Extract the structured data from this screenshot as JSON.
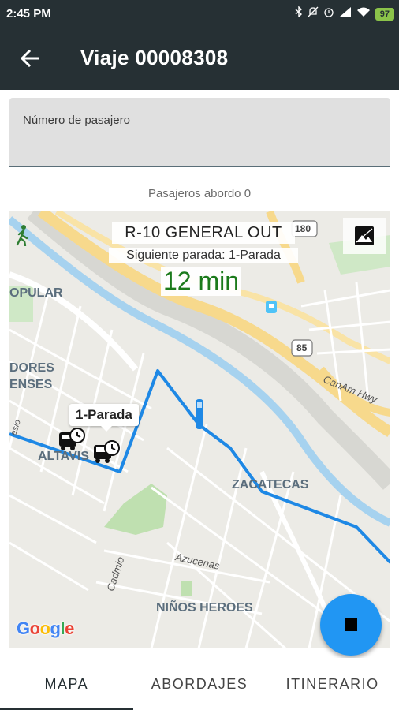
{
  "status_bar": {
    "time": "2:45 PM",
    "battery": "97",
    "icons": [
      "bluetooth-icon",
      "mute-icon",
      "alarm-icon",
      "signal-icon",
      "wifi-icon",
      "battery-icon"
    ]
  },
  "app_bar": {
    "back_icon": "arrow-left-icon",
    "title": "Viaje 00008308"
  },
  "passenger_field": {
    "label": "Número de pasajero",
    "value": ""
  },
  "aboard_text": "Pasajeros abordo 0",
  "map": {
    "route_name": "R-10 GENERAL OUT",
    "next_stop": "Siguiente parada: 1-Parada",
    "eta": "12 min",
    "stop_tooltip": "1-Parada",
    "labels": {
      "popular": "OPULAR",
      "dores": "DORES",
      "enses": "ENSES",
      "altavis": "ALTAVIS",
      "zacatecas": "ZACATECAS",
      "azucenas": "Azucenas",
      "cadmio": "Cadmio",
      "ninos_heroes": "NIÑOS HEROES",
      "canam": "CanAm Hwy",
      "hwy_180": "180",
      "hwy_85": "85",
      "esio": "esio"
    },
    "google": [
      "G",
      "o",
      "o",
      "g",
      "l",
      "e"
    ],
    "google_colors": [
      "#4285F4",
      "#EA4335",
      "#FBBC05",
      "#4285F4",
      "#34A853",
      "#EA4335"
    ],
    "route_color": "#1e88e5"
  },
  "fab": {
    "icon": "stop-icon",
    "color": "#2196f3"
  },
  "tabs": [
    {
      "label": "MAPA",
      "active": true
    },
    {
      "label": "ABORDAJES",
      "active": false
    },
    {
      "label": "ITINERARIO",
      "active": false
    }
  ]
}
